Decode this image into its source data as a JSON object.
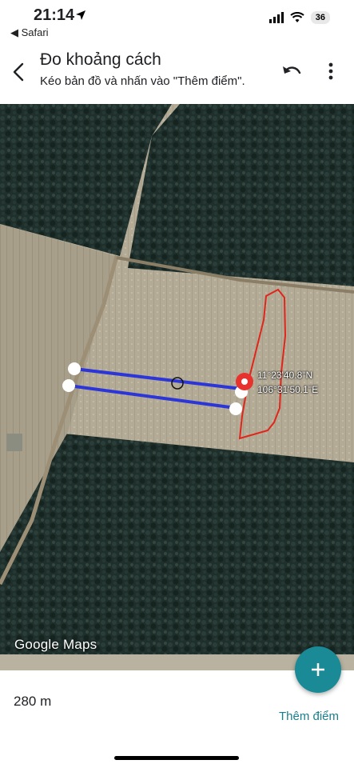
{
  "status_bar": {
    "time": "21:14",
    "back_app": "◀ Safari",
    "battery": "36"
  },
  "header": {
    "title": "Đo khoảng cách",
    "subtitle": "Kéo bản đồ và nhấn vào \"Thêm điểm\"."
  },
  "map": {
    "coordinates": {
      "lat": "11°23'40.8\"N",
      "lon": "106°31'50.1\"E"
    },
    "attribution": "Google Maps",
    "colors": {
      "measure_line": "#2b35d8",
      "boundary": "#e0261b",
      "pin": "#e8322e"
    }
  },
  "footer": {
    "distance": "280 m",
    "add_point_label": "Thêm điểm"
  },
  "icons": [
    "location-arrow-icon",
    "signal-icon",
    "wifi-icon",
    "back-arrow-icon",
    "undo-icon",
    "more-vertical-icon",
    "plus-icon",
    "location-pin-icon"
  ]
}
